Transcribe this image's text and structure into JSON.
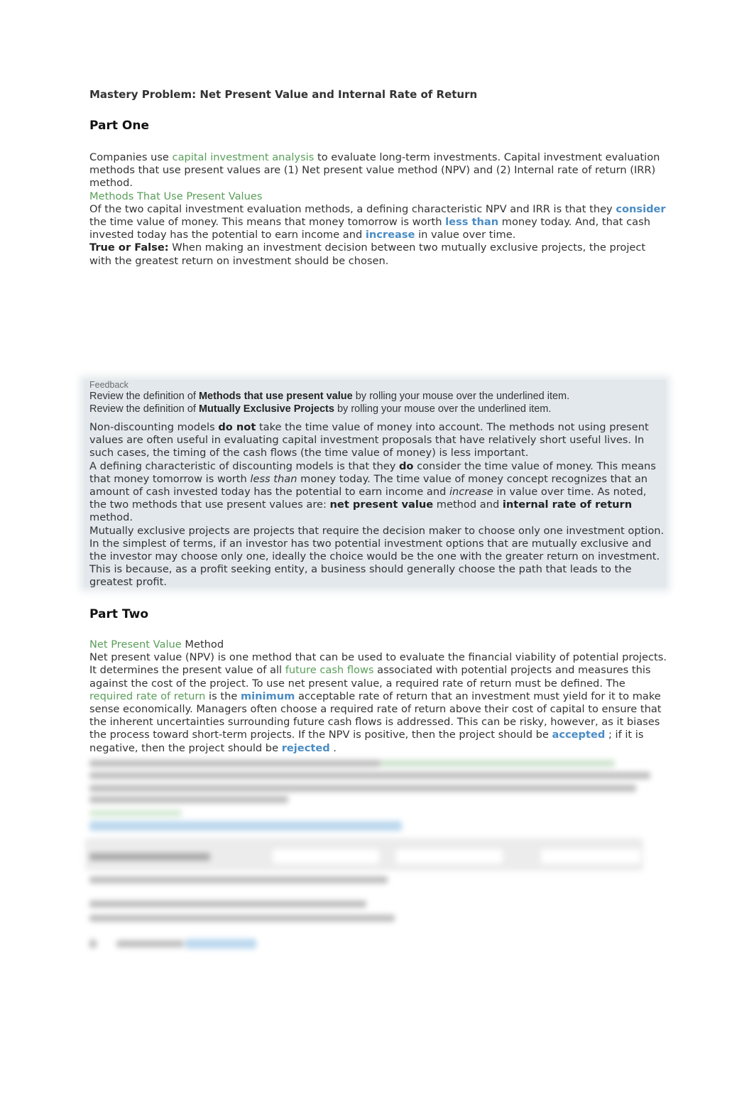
{
  "title": "Mastery Problem: Net Present Value and Internal Rate of Return",
  "part_one": {
    "heading": "Part One",
    "intro": {
      "t1": "Companies use ",
      "link1": "capital investment analysis",
      "t2": " to evaluate long-term investments. Capital investment evaluation methods that use present values are (1) Net present value method (NPV) and (2) Internal rate of return (IRR) method."
    },
    "section_link": "Methods That Use Present Values",
    "question": {
      "t1": "Of the two capital investment evaluation methods, a defining characteristic NPV and IRR is that they ",
      "blank1": "consider",
      "t2": "  the time value of money. This means that money tomorrow is worth ",
      "blank2": "less than",
      "t3": "  money today. And, that cash invested today has the potential to earn income and ",
      "blank3": "increase",
      "t4": "  in value over time."
    },
    "true_false": {
      "label": "True or False:",
      "text": " When making an investment decision between two mutually exclusive projects, the project with the greatest return on investment should be chosen."
    }
  },
  "feedback": {
    "label": "Feedback",
    "line1": {
      "t1": "Review the definition of ",
      "bold": "Methods that use present value",
      "t2": " by rolling your mouse over the underlined item."
    },
    "line2": {
      "t1": "Review the definition of ",
      "bold": "Mutually Exclusive Projects",
      "t2": " by rolling your mouse over the underlined item."
    },
    "p1": {
      "t1": "Non-discounting models ",
      "b1": "do not",
      "t2": " take the time value of money into account. The methods not using present values are often useful in evaluating capital investment proposals that have relatively short useful lives. In such cases, the timing of the cash flows (the time value of money) is less important."
    },
    "p2": {
      "t1": "A defining characteristic of discounting models is that they ",
      "b1": "do",
      "t2": " consider the time value of money. This means that money tomorrow is worth ",
      "i1": "less than",
      "t3": " money today. The time value of money concept recognizes that an amount of cash invested today has the potential to earn income and ",
      "i2": "increase",
      "t4": " in value over time. As noted, the two methods that use present values are: ",
      "b2": "net present value",
      "t5": " method and ",
      "b3": "internal rate of return",
      "t6": " method."
    },
    "p3": "Mutually exclusive projects are projects that require the decision maker to choose only one investment option. In the simplest of terms, if an investor has two potential investment options that are mutually exclusive and the investor may choose only one, ideally the choice would be the one with the greater return on investment. This is because, as a profit seeking entity, a business should generally choose the path that leads to the greatest profit."
  },
  "part_two": {
    "heading": "Part Two",
    "section_link": "Net Present Value",
    "section_suffix": " Method",
    "para": {
      "t1": "Net present value (NPV) is one method that can be used to evaluate the financial viability of potential projects. It determines the present value of all ",
      "link1": "future cash flows",
      "t2": " associated with potential projects and measures this against the cost of the project. To use net present value, a required rate of return must be defined. The ",
      "link2": "required rate of return",
      "t3": " is the ",
      "blank1": "minimum",
      "t4": "  acceptable rate of return that an investment must yield for it to make sense economically. Managers often choose a required rate of return above their cost of capital to ensure that the inherent uncertainties surrounding future cash flows is addressed. This can be risky, however, as it biases the process toward short-term projects. If the NPV is positive, then the project should be ",
      "blank2": "accepted",
      "t5": " ; if it is negative, then the project should be ",
      "blank3": "rejected",
      "t6": " ."
    }
  },
  "colors": {
    "link_green": "#5a9e5a",
    "answer_blue": "#4a8cc4",
    "feedback_bg": "#e2e8ec"
  }
}
